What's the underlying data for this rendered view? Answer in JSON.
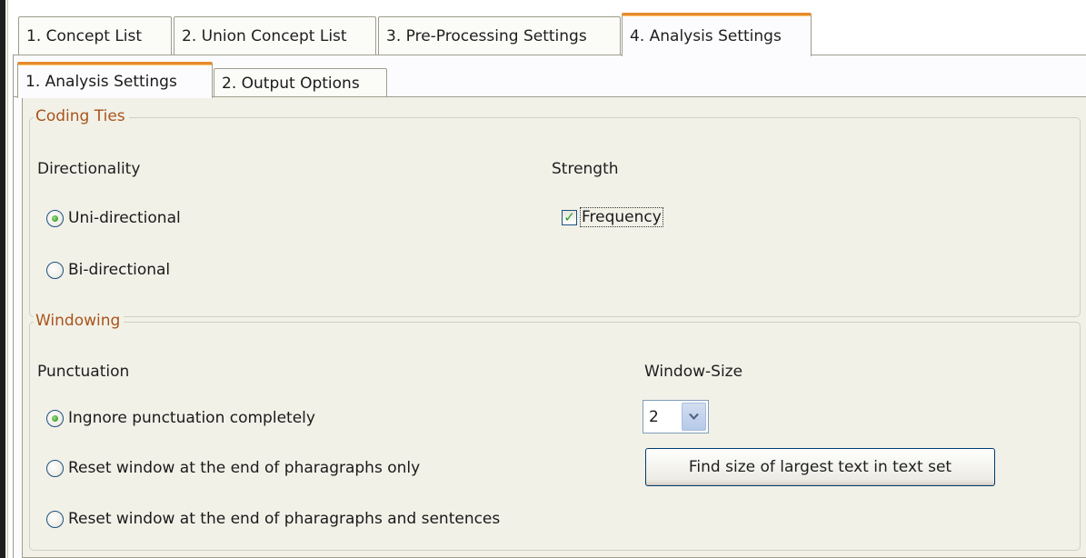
{
  "main_tabs": [
    {
      "label": "1. Concept List"
    },
    {
      "label": "2. Union Concept List"
    },
    {
      "label": "3. Pre-Processing Settings"
    },
    {
      "label": "4. Analysis Settings",
      "active": true
    }
  ],
  "sub_tabs": [
    {
      "label": "1. Analysis Settings",
      "active": true
    },
    {
      "label": "2. Output Options"
    }
  ],
  "coding_ties": {
    "title": "Coding Ties",
    "directionality": {
      "label": "Directionality",
      "options": [
        {
          "label": "Uni-directional",
          "checked": true
        },
        {
          "label": "Bi-directional",
          "checked": false
        }
      ]
    },
    "strength": {
      "label": "Strength",
      "frequency": {
        "label": "Frequency",
        "checked": true
      }
    }
  },
  "windowing": {
    "title": "Windowing",
    "punctuation": {
      "label": "Punctuation",
      "options": [
        {
          "label": "Ingnore punctuation completely",
          "checked": true
        },
        {
          "label": "Reset window at the end of pharagraphs only",
          "checked": false
        },
        {
          "label": "Reset window at the end of pharagraphs and sentences",
          "checked": false
        }
      ]
    },
    "window_size": {
      "label": "Window-Size",
      "value": "2"
    },
    "find_size_button": "Find size of largest text in text set"
  },
  "colors": {
    "active_tab_accent": "#e68b2c",
    "group_title": "#a8541c",
    "radio_checked": "#21a121",
    "panel_background": "#f2f1e8"
  },
  "icons": {
    "radio": "radio-button",
    "checkbox": "checkmark",
    "spinner": "chevron-down-icon"
  }
}
